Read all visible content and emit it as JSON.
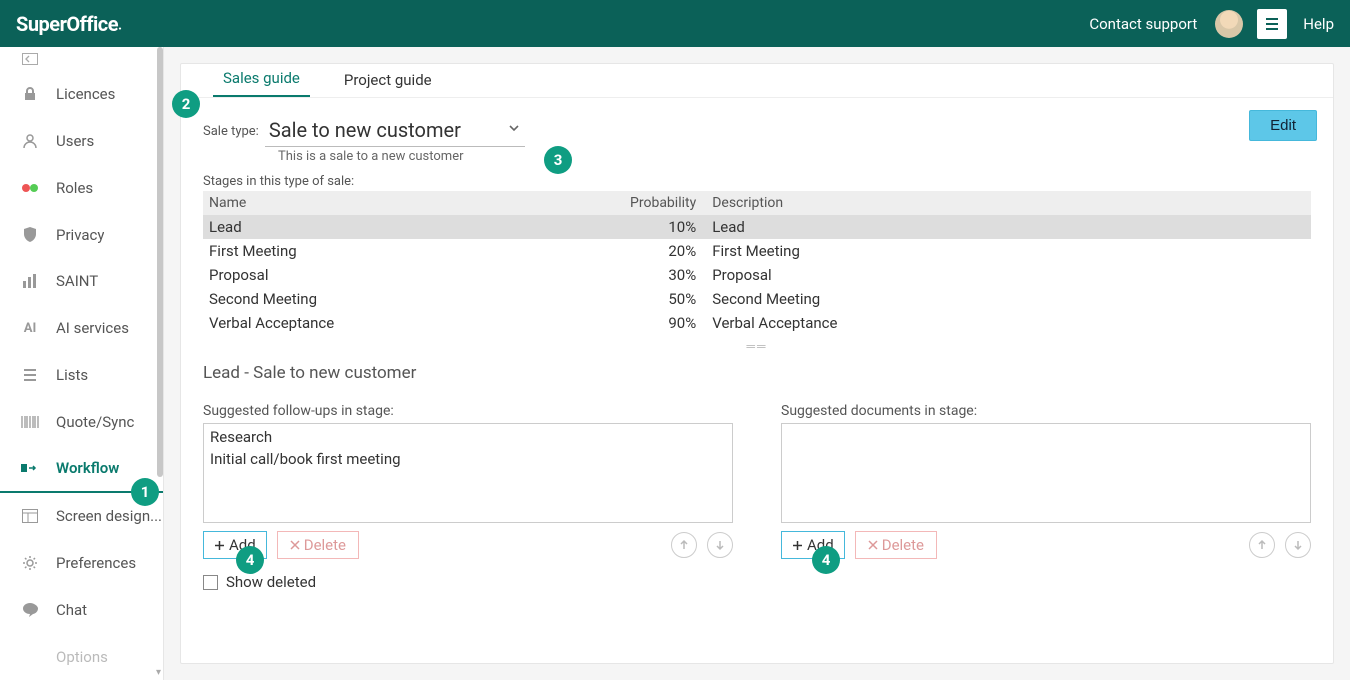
{
  "topbar": {
    "logo": "SuperOffice",
    "contact": "Contact support",
    "help": "Help"
  },
  "sidebar": {
    "items": [
      {
        "label": "Licences"
      },
      {
        "label": "Users"
      },
      {
        "label": "Roles"
      },
      {
        "label": "Privacy"
      },
      {
        "label": "SAINT"
      },
      {
        "label": "AI services"
      },
      {
        "label": "Lists"
      },
      {
        "label": "Quote/Sync"
      },
      {
        "label": "Workflow"
      },
      {
        "label": "Screen design..."
      },
      {
        "label": "Preferences"
      },
      {
        "label": "Chat"
      },
      {
        "label": "Options"
      }
    ]
  },
  "tabs": {
    "sales": "Sales guide",
    "project": "Project guide"
  },
  "saletype": {
    "label": "Sale type:",
    "value": "Sale to new customer",
    "desc": "This is a sale to a new customer"
  },
  "edit_label": "Edit",
  "stages": {
    "label": "Stages in this type of sale:",
    "headers": {
      "name": "Name",
      "prob": "Probability",
      "desc": "Description"
    },
    "rows": [
      {
        "name": "Lead",
        "prob": "10%",
        "desc": "Lead"
      },
      {
        "name": "First Meeting",
        "prob": "20%",
        "desc": "First Meeting"
      },
      {
        "name": "Proposal",
        "prob": "30%",
        "desc": "Proposal"
      },
      {
        "name": "Second Meeting",
        "prob": "50%",
        "desc": "Second Meeting"
      },
      {
        "name": "Verbal Acceptance",
        "prob": "90%",
        "desc": "Verbal Acceptance"
      }
    ]
  },
  "detail_title": "Lead - Sale to new customer",
  "followups": {
    "label": "Suggested follow-ups in stage:",
    "items": [
      "Research",
      "Initial call/book first meeting"
    ],
    "add": "Add",
    "delete": "Delete"
  },
  "docs": {
    "label": "Suggested documents in stage:",
    "add": "Add",
    "delete": "Delete"
  },
  "show_deleted": "Show deleted",
  "badges": {
    "b1": "1",
    "b2": "2",
    "b3": "3",
    "b4": "4"
  }
}
